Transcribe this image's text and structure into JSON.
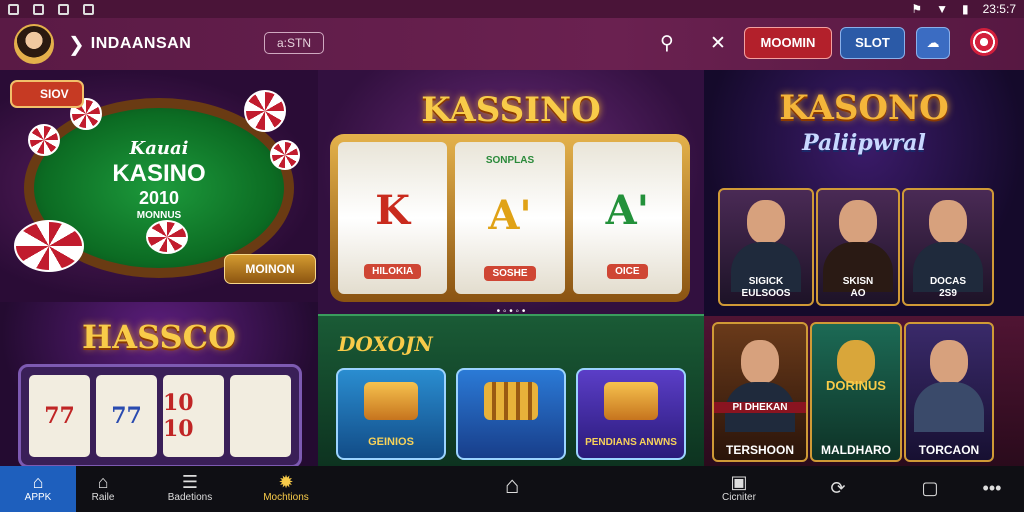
{
  "status": {
    "time": "23:5:7"
  },
  "app_bar": {
    "title": "INDAANSAN",
    "search_text": "a:STN",
    "red_button": "MOOMIN",
    "blue_button": "SLOT",
    "icons": [
      "search-icon",
      "close-icon",
      "chat-icon",
      "gift-icon"
    ]
  },
  "panel_table": {
    "badge": "SIOV",
    "line1": "Kauai",
    "line2": "KASINO",
    "line3": "2010",
    "line4": "MONNUS",
    "button": "MOINON"
  },
  "panel_slot": {
    "title": "KASSINO",
    "reels": [
      {
        "top": "",
        "symbol": "K",
        "label": "HILOKIA"
      },
      {
        "top": "SONPLAS",
        "symbol": "A'",
        "label": "SOSHE"
      },
      {
        "top": "",
        "symbol": "A'",
        "label": "OICE"
      }
    ],
    "dots": "• ◦ • ◦ •"
  },
  "panel_portraits": {
    "title": "KASONO",
    "subtitle": "Paliipwral",
    "people": [
      {
        "caption1": "SIGICK",
        "caption2": "EULSOOS"
      },
      {
        "caption1": "SKISN",
        "caption2": "AO"
      },
      {
        "caption1": "DOCAS",
        "caption2": "2S9"
      }
    ]
  },
  "panel_reels": {
    "title": "HASSCO",
    "reels": [
      "77",
      "77",
      "10 10",
      ""
    ]
  },
  "panel_bonus": {
    "title": "DOXOJN",
    "tiles": [
      {
        "label": "GEINIOS"
      },
      {
        "label": ""
      },
      {
        "label": "PENDIANS ANWNS"
      }
    ]
  },
  "panel_cards": {
    "banner": "PI DHEKAN",
    "cards": [
      {
        "label": "TERSHOON"
      },
      {
        "label": "MALDHARO"
      },
      {
        "label": "TORCAON"
      }
    ],
    "art_label": "DORINUS"
  },
  "nav": {
    "items": [
      {
        "label": "APPK",
        "icon": "home-icon"
      },
      {
        "label": "Raile",
        "icon": "home-outline-icon"
      },
      {
        "label": "Badetions",
        "icon": "menu-icon"
      },
      {
        "label": "Mochtions",
        "icon": "chip-icon"
      },
      {
        "label": "",
        "icon": "home-button-icon"
      },
      {
        "label": "Cicniter",
        "icon": "camera-icon"
      },
      {
        "label": "",
        "icon": "refresh-icon"
      },
      {
        "label": "",
        "icon": "square-icon"
      },
      {
        "label": "",
        "icon": "more-icon"
      }
    ]
  },
  "colors": {
    "accent": "#1e5fbd",
    "app_bar": "#5a1a45",
    "gold": "#f8cb49",
    "red_button": "#b3202b",
    "blue_button": "#2b5aa7"
  }
}
